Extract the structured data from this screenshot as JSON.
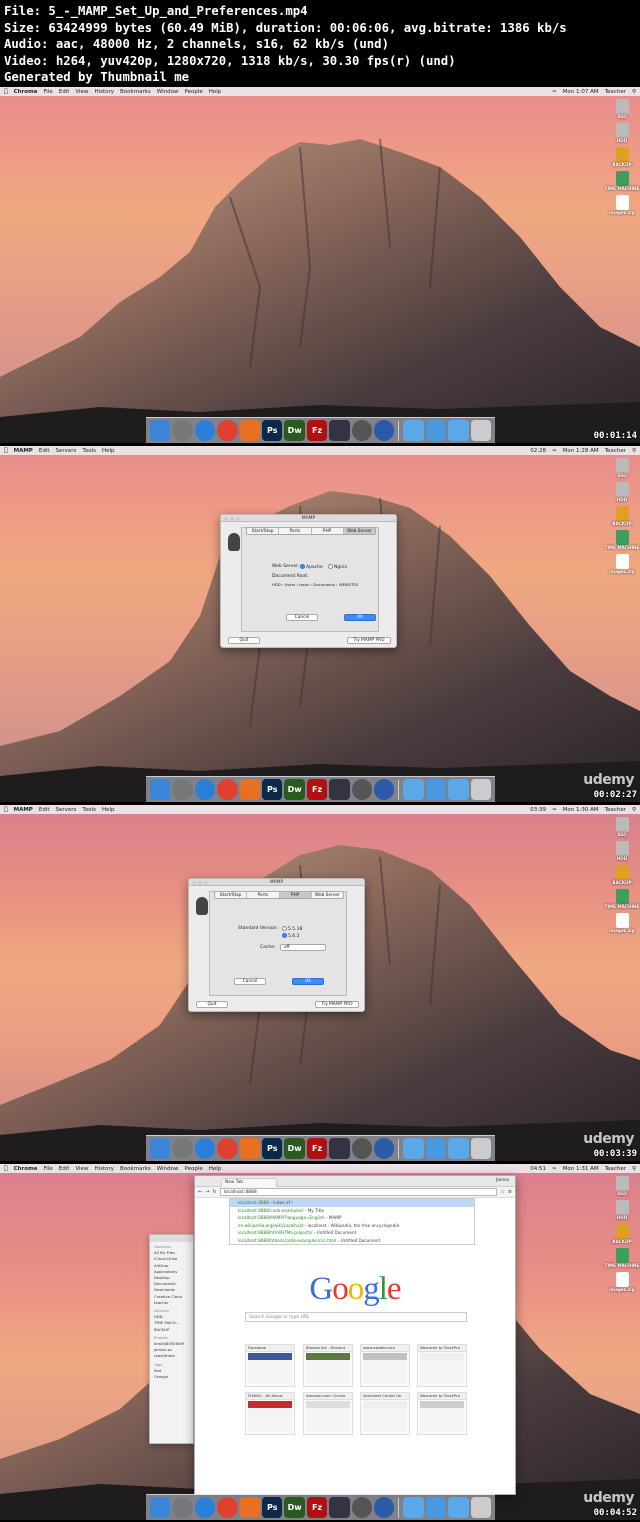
{
  "header": {
    "line1": "File: 5_-_MAMP_Set_Up_and_Preferences.mp4",
    "line2": "Size: 63424999 bytes (60.49 MiB), duration: 00:06:06, avg.bitrate: 1386 kb/s",
    "line3": "Audio: aac, 48000 Hz, 2 channels, s16, 62 kb/s (und)",
    "line4": "Video: h264, yuv420p, 1280x720, 1318 kb/s, 30.30 fps(r) (und)",
    "line5": "Generated by Thumbnail me"
  },
  "desktop_icons": [
    "SSD",
    "HDD",
    "BACKUP",
    "TIME MACHINE",
    "images.zip"
  ],
  "frames": [
    {
      "timecode": "00:01:14",
      "menubar": {
        "app": "Chrome",
        "items": [
          "File",
          "Edit",
          "View",
          "History",
          "Bookmarks",
          "Window",
          "People",
          "Help"
        ],
        "clock": "Mon 1:07 AM",
        "user": "Teacher"
      }
    },
    {
      "timecode": "00:02:27",
      "menubar": {
        "app": "MAMP",
        "items": [
          "Edit",
          "Servers",
          "Tools",
          "Help"
        ],
        "clock": "Mon 1:28 AM",
        "user": "Teacher",
        "timer": "02:28"
      },
      "mamp": {
        "title": "MAMP",
        "tabs": [
          "Start/Stop",
          "Ports",
          "PHP",
          "Web Server"
        ],
        "selected_tab": "Web Server",
        "web_server_label": "Web Server:",
        "apache": "Apache",
        "nginx": "Nginx",
        "doc_root_label": "Document Root:",
        "path": "HDD › Users › Jason › Documents › WEBSITES",
        "cancel": "Cancel",
        "ok": "OK",
        "quit": "Quit",
        "try_pro": "Try MAMP PRO"
      }
    },
    {
      "timecode": "00:03:39",
      "menubar": {
        "app": "MAMP",
        "items": [
          "Edit",
          "Servers",
          "Tools",
          "Help"
        ],
        "clock": "Mon 1:30 AM",
        "user": "Teacher",
        "timer": "03:39"
      },
      "mamp": {
        "title": "MAMP",
        "tabs": [
          "Start/Stop",
          "Ports",
          "PHP",
          "Web Server"
        ],
        "selected_tab": "PHP",
        "std_version_label": "Standard Version:",
        "v1": "5.5.18",
        "v2": "5.6.2",
        "cache_label": "Cache:",
        "cache_value": "off",
        "cancel": "Cancel",
        "ok": "OK",
        "quit": "Quit",
        "try_pro": "Try MAMP PRO"
      }
    },
    {
      "timecode": "00:04:52",
      "menubar": {
        "app": "Chrome",
        "items": [
          "File",
          "Edit",
          "View",
          "History",
          "Bookmarks",
          "Window",
          "People",
          "Help"
        ],
        "clock": "Mon 1:31 AM",
        "user": "Teacher",
        "timer": "04:51"
      },
      "chrome": {
        "tab": "New Tab",
        "user": "James",
        "url": "localhost:8888",
        "suggestions": [
          {
            "url": "localhost:8888",
            "text": " - Index of /"
          },
          {
            "url": "localhost:8888/code-examples/",
            "text": " - My Title"
          },
          {
            "url": "localhost:8888/MAMP/?language=English",
            "text": " - MAMP"
          },
          {
            "url": "en.wikipedia.org/wiki/Localhost",
            "text": " - localhost - Wikipedia, the free encyclopedia"
          },
          {
            "url": "localhost:8888/html/HTML-projects/",
            "text": " - Untitled Document"
          },
          {
            "url": "localhost:8888/htdocs/code-examples/css.html",
            "text": " - Untitled Document"
          }
        ],
        "logo": "Google",
        "search_placeholder": "Search Google or type URL",
        "tiles": [
          "Facebook",
          "Browse Art - Deviant",
          "www.ewebb.com",
          "Welcome to ClockPro",
          "FIXKKU - All About",
          "Amazon.com: Online",
          "Volunteer Center for",
          "Welcome to ClockPro"
        ]
      },
      "finder": {
        "favorites_label": "Favorites",
        "favorites": [
          "All My Files",
          "iCloud Drive",
          "AirDrop",
          "Applications",
          "Desktop",
          "Documents",
          "Downloads",
          "Creative Cloud",
          "teacher"
        ],
        "devices_label": "Devices",
        "devices": [
          "HDD",
          "TIME MACH...",
          "BACKUP"
        ],
        "shared_label": "Shared",
        "shared": [
          "brw0080926d5f",
          "jamies-pc",
          "readythere"
        ],
        "tags_label": "Tags",
        "tags": [
          "Red",
          "Orange"
        ]
      }
    }
  ],
  "dock_apps": [
    "finder-icon",
    "system-prefs-icon",
    "safari-icon",
    "chrome-icon",
    "firefox-icon",
    "photoshop-icon",
    "dreamweaver-icon",
    "filezilla-icon",
    "movie-icon",
    "mamp-icon",
    "quicktime-icon",
    "folder-icon",
    "downloads-icon",
    "folder-icon",
    "trash-icon"
  ],
  "dock_labels": {
    "ps": "Ps",
    "dw": "Dw",
    "fz": "Fz"
  },
  "watermark": "udemy"
}
